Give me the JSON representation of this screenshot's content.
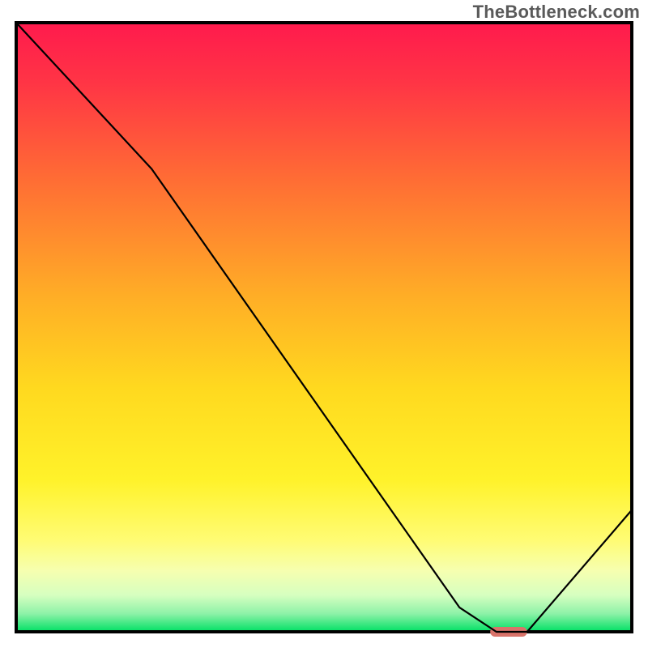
{
  "watermark": "TheBottleneck.com",
  "chart_data": {
    "type": "line",
    "title": "",
    "xlabel": "",
    "ylabel": "",
    "xlim": [
      0,
      100
    ],
    "ylim": [
      0,
      100
    ],
    "series": [
      {
        "name": "curve",
        "x": [
          0,
          22,
          72,
          78,
          83,
          100
        ],
        "values": [
          100,
          76,
          4,
          0,
          0,
          20
        ]
      }
    ],
    "marker": {
      "name": "optimal-range",
      "x_start": 77,
      "x_end": 83,
      "y": 0,
      "color": "#d9736a"
    },
    "background_gradient": {
      "stops": [
        {
          "offset": 0.0,
          "color": "#ff1a4d"
        },
        {
          "offset": 0.1,
          "color": "#ff3545"
        },
        {
          "offset": 0.25,
          "color": "#ff6a35"
        },
        {
          "offset": 0.45,
          "color": "#ffae26"
        },
        {
          "offset": 0.6,
          "color": "#ffd91f"
        },
        {
          "offset": 0.75,
          "color": "#fff22a"
        },
        {
          "offset": 0.85,
          "color": "#fffc74"
        },
        {
          "offset": 0.9,
          "color": "#f6ffb0"
        },
        {
          "offset": 0.94,
          "color": "#d6ffc0"
        },
        {
          "offset": 0.97,
          "color": "#8ef2a8"
        },
        {
          "offset": 1.0,
          "color": "#00e064"
        }
      ]
    },
    "border_color": "#000000",
    "curve_color": "#000000",
    "curve_width": 2.2
  }
}
